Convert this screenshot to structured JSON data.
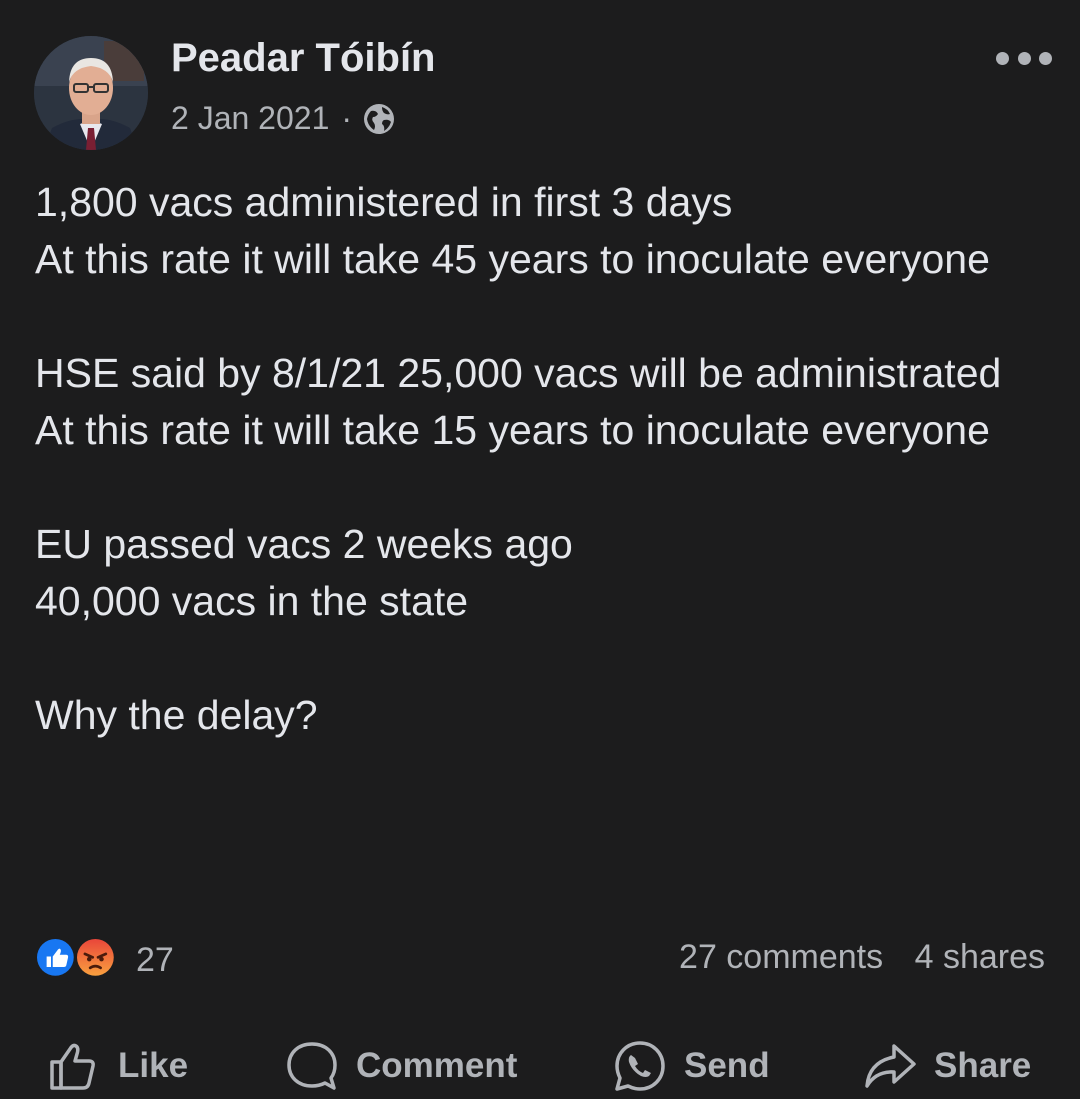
{
  "post": {
    "author": "Peadar Tóibín",
    "date": "2 Jan 2021",
    "separator": "·",
    "privacy_icon": "globe-icon",
    "paragraphs": [
      "1,800 vacs administered in first 3 days\nAt this rate it will take 45 years to inoculate everyone",
      "HSE said by 8/1/21 25,000 vacs will be administrated\nAt this rate it will take 15 years to inoculate everyone",
      "EU passed vacs 2 weeks ago\n40,000 vacs in the state",
      "Why the delay?"
    ]
  },
  "reactions": {
    "icons": [
      "like-reaction-icon",
      "angry-reaction-icon"
    ],
    "count": "27",
    "comments": "27 comments",
    "shares": "4 shares"
  },
  "actions": {
    "like": "Like",
    "comment": "Comment",
    "send": "Send",
    "share": "Share"
  },
  "colors": {
    "background": "#1c1c1d",
    "text": "#e4e6eb",
    "secondary_text": "#b0b3b8",
    "like_blue": "#1877f2",
    "angry_orange": "#f0712a"
  }
}
